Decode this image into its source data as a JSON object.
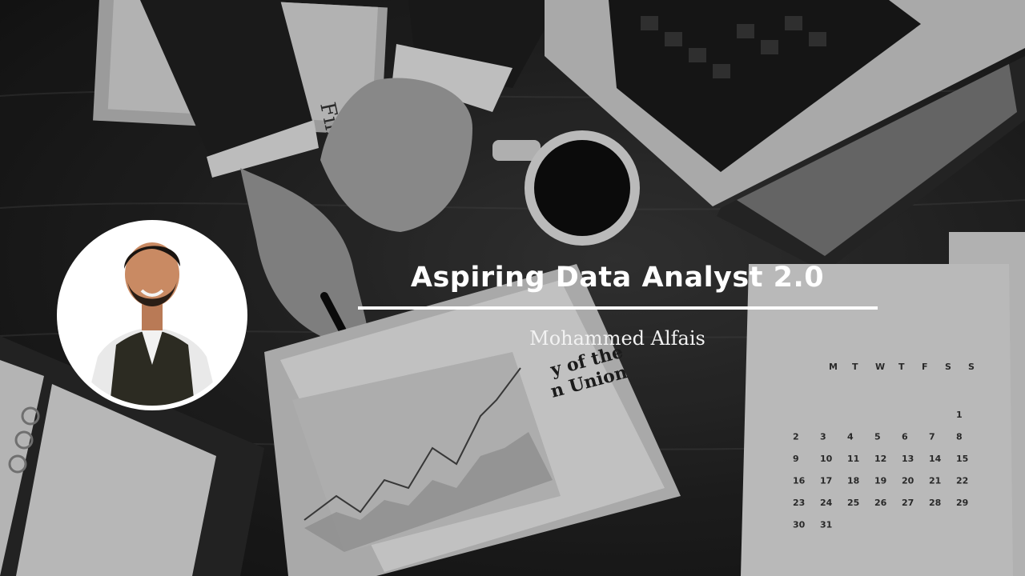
{
  "banner": {
    "title": "Aspiring Data Analyst 2.0",
    "name": "Mohammed Alfais"
  },
  "background": {
    "calendar": {
      "weekdays": [
        "M",
        "T",
        "W",
        "T",
        "F",
        "S",
        "S"
      ],
      "days": [
        "1",
        "2",
        "3",
        "4",
        "5",
        "6",
        "7",
        "8",
        "9",
        "10",
        "11",
        "12",
        "13",
        "14",
        "15",
        "16",
        "17",
        "18",
        "19",
        "20",
        "21",
        "22",
        "23",
        "24",
        "25",
        "26",
        "27",
        "28",
        "29",
        "30",
        "31"
      ]
    },
    "newspaper_headline": [
      "y of the",
      "n Union"
    ]
  },
  "colors": {
    "text": "#ffffff",
    "divider": "#ffffff",
    "avatar_border": "#ffffff",
    "background": "#1b1b1b"
  }
}
